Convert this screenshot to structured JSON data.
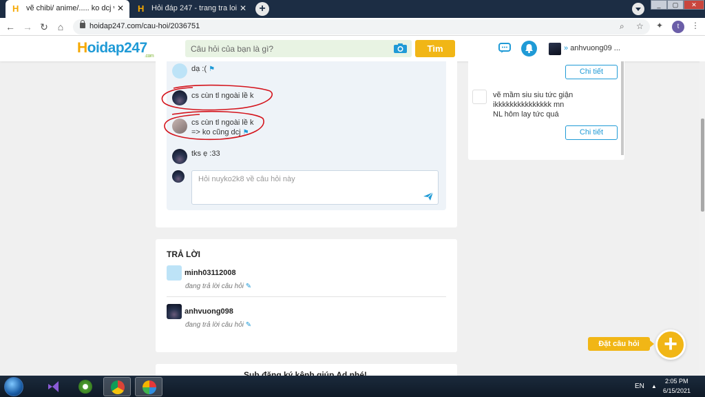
{
  "browser": {
    "tabs": [
      {
        "title": "vẽ chibi/ anime/..... ko dcj vẽ ẩu c"
      },
      {
        "title": "Hỏi đáp 247 - trang tra loi"
      }
    ],
    "url": "hoidap247.com/cau-hoi/2036751",
    "profile_initial": "t"
  },
  "site": {
    "logo_text": "oidap247",
    "logo_h": "H",
    "logo_suffix": ".com",
    "search_placeholder": "Câu hỏi của bạn là gì?",
    "search_button": "Tìm",
    "username": "anhvuong09 ..."
  },
  "comments": [
    {
      "avatar": "light",
      "text": "dạ :(",
      "flag": true
    },
    {
      "avatar": "dark",
      "text": "cs cùn tl ngoài lề k",
      "flag": false
    },
    {
      "avatar": "anime",
      "text": "cs cùn tl ngoài lề k\n=> ko cũng dcj",
      "flag": true
    },
    {
      "avatar": "dark",
      "text": "tks ẹ :33",
      "flag": false
    }
  ],
  "reply_placeholder": "Hỏi nuyko2k8 về câu hỏi này",
  "answers": {
    "title": "TRẢ LỜI",
    "items": [
      {
        "name": "minh03112008",
        "status": "đang trả lời câu hỏi"
      },
      {
        "name": "anhvuong098",
        "status": "đang trả lời câu hỏi"
      }
    ]
  },
  "bottom_card_text": "Sub đăng ký kênh giúp Ad nhé!",
  "sidebar": {
    "detail_label": "Chi tiết",
    "post_text": "vẽ mầm siu siu tức giận\nikkkkkkkkkkkkkkk mn\nNL hôm lay tức quá"
  },
  "fab_label": "Đặt câu hỏi",
  "taskbar": {
    "lang": "EN",
    "time": "2:05 PM",
    "date": "6/15/2021"
  },
  "colors": {
    "brand_blue": "#1f9ad6",
    "brand_yellow": "#f1b616",
    "brand_green": "#7bb32e"
  }
}
